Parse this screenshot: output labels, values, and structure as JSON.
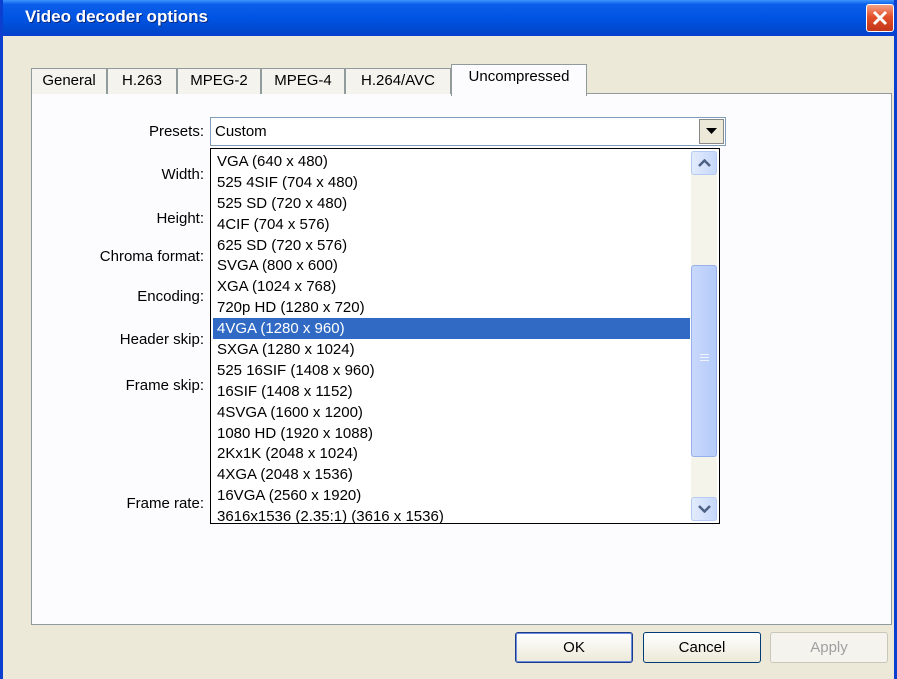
{
  "window": {
    "title": "Video decoder options"
  },
  "tabs": [
    "General",
    "H.263",
    "MPEG-2",
    "MPEG-4",
    "H.264/AVC",
    "Uncompressed"
  ],
  "active_tab": "Uncompressed",
  "form": {
    "presets_label": "Presets:",
    "presets_value": "Custom",
    "width_label": "Width:",
    "height_label": "Height:",
    "chroma_label": "Chroma format:",
    "encoding_label": "Encoding:",
    "header_skip_label": "Header skip:",
    "frame_skip_label": "Frame skip:",
    "frame_rate_label": "Frame rate:"
  },
  "preset_options": [
    "VGA (640 x 480)",
    "525 4SIF (704 x 480)",
    "525 SD (720 x 480)",
    "4CIF (704 x 576)",
    "625 SD (720 x 576)",
    "SVGA (800 x 600)",
    "XGA (1024 x 768)",
    "720p HD (1280 x 720)",
    "4VGA (1280 x 960)",
    "SXGA (1280 x 1024)",
    "525 16SIF (1408 x 960)",
    "16SIF (1408 x 1152)",
    "4SVGA (1600 x 1200)",
    "1080 HD (1920 x 1088)",
    "2Kx1K (2048 x 1024)",
    "4XGA (2048 x 1536)",
    "16VGA (2560 x 1920)",
    "3616x1536 (2.35:1) (3616 x 1536)"
  ],
  "selected_option": "4VGA (1280 x 960)",
  "buttons": {
    "ok": "OK",
    "cancel": "Cancel",
    "apply": "Apply"
  },
  "colors": {
    "title_bar": "#0054e3",
    "selection": "#316ac5",
    "dialog_bg": "#ece9d8",
    "close_button": "#e3502a"
  }
}
